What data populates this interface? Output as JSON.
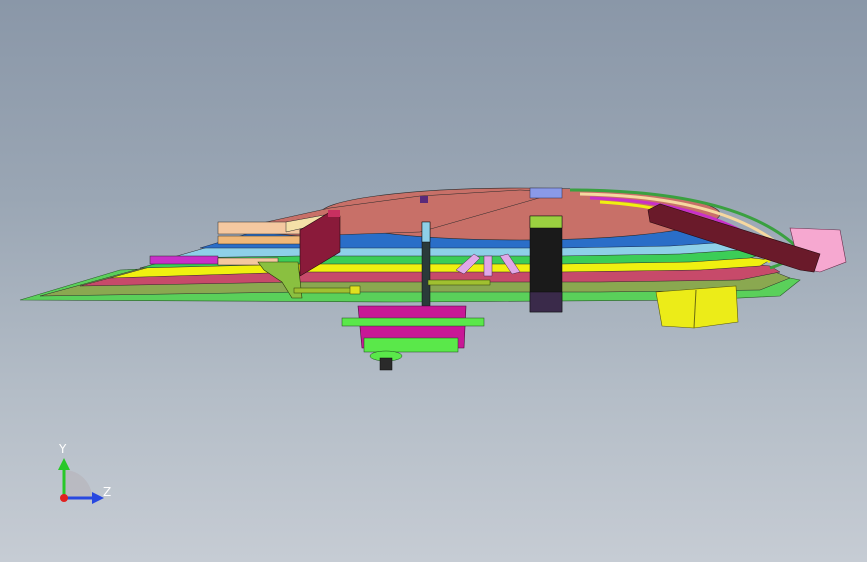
{
  "viewport": {
    "background_top": "#8a97a8",
    "background_bottom": "#c6ccd4"
  },
  "triad": {
    "y_label": "Y",
    "z_label": "Z",
    "y_color": "#28c828",
    "z_color": "#2848e0",
    "x_color": "#e02020"
  },
  "model": {
    "colors": {
      "top_skin": "#c87068",
      "blue_layer": "#2a6ec8",
      "cyan_layer": "#8ed0e8",
      "green_layer": "#3ccd57",
      "yellow_layer": "#f0f010",
      "magenta_layer": "#c830c8",
      "olive_layer": "#8aa850",
      "bottom_layer": "#5ad05a",
      "pink_tip": "#f6a8d0",
      "yellow_block": "#ecec18",
      "motor_body": "#c81896",
      "motor_base": "#5ae84a"
    }
  }
}
